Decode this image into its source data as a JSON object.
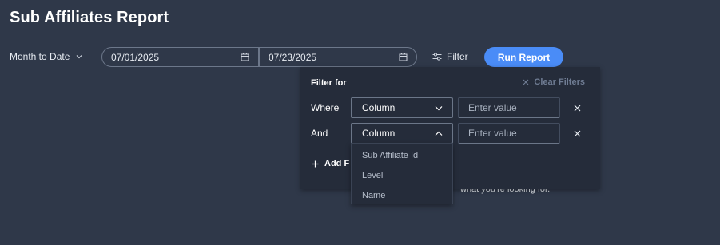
{
  "page": {
    "title": "Sub Affiliates Report"
  },
  "toolbar": {
    "range_label": "Month to Date",
    "start_date": "07/01/2025",
    "end_date": "07/23/2025",
    "filter_label": "Filter",
    "run_label": "Run Report",
    "run_color": "#4a8cf7"
  },
  "background_hint": "what you're looking for.",
  "filter_panel": {
    "title": "Filter for",
    "clear_label": "Clear Filters",
    "rows": [
      {
        "label": "Where",
        "column": "Column",
        "placeholder": "Enter value",
        "open": false
      },
      {
        "label": "And",
        "column": "Column",
        "placeholder": "Enter value",
        "open": true
      }
    ],
    "add_label": "Add F"
  },
  "column_dropdown": {
    "options": [
      "Sub Affiliate Id",
      "Level",
      "Name"
    ]
  },
  "icons": {
    "range": "chevron-down-icon",
    "date": "calendar-icon",
    "filter": "sliders-icon",
    "clear": "close-icon",
    "remove": "close-icon",
    "add": "plus-icon"
  }
}
